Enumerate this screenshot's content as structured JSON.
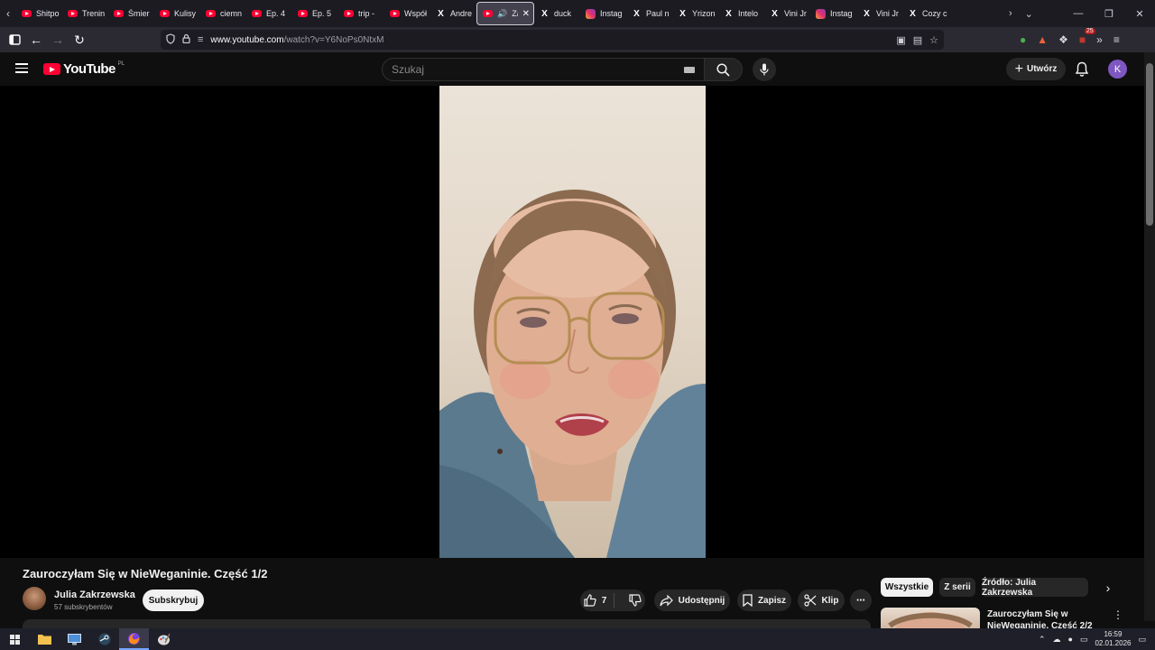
{
  "browser": {
    "tabs": [
      {
        "label": "Shitpo",
        "icon": "youtube-icon"
      },
      {
        "label": "Trenin",
        "icon": "youtube-icon"
      },
      {
        "label": "Śmier",
        "icon": "youtube-icon"
      },
      {
        "label": "Kulisy",
        "icon": "youtube-icon"
      },
      {
        "label": "ciemn",
        "icon": "youtube-icon"
      },
      {
        "label": "Ep. 4",
        "icon": "youtube-icon"
      },
      {
        "label": "Ep. 5",
        "icon": "youtube-icon"
      },
      {
        "label": "trip -",
        "icon": "youtube-icon"
      },
      {
        "label": "Współ",
        "icon": "youtube-icon"
      },
      {
        "label": "Andre",
        "icon": "x-icon"
      },
      {
        "label": "Zau",
        "icon": "youtube-icon",
        "active": true
      },
      {
        "label": "duck",
        "icon": "x-icon"
      },
      {
        "label": "Instag",
        "icon": "instagram-icon"
      },
      {
        "label": "Paul n",
        "icon": "x-icon"
      },
      {
        "label": "Yrizon",
        "icon": "x-icon"
      },
      {
        "label": "Intelo",
        "icon": "x-icon"
      },
      {
        "label": "Vini Jr",
        "icon": "x-icon"
      },
      {
        "label": "Instag",
        "icon": "instagram-icon"
      },
      {
        "label": "Vini Jr",
        "icon": "x-icon"
      },
      {
        "label": "Cozy c",
        "icon": "x-icon"
      }
    ],
    "url_domain": "www.youtube.com",
    "url_path": "/watch?v=Y6NoPs0NtxM",
    "extension_badge": "25"
  },
  "youtube": {
    "logo_text": "YouTube",
    "country_code": "PL",
    "search_placeholder": "Szukaj",
    "create_label": "Utwórz",
    "avatar_letter": "K",
    "avatar_color": "#7e57c2"
  },
  "video": {
    "title": "Zauroczyłam Się w NieWeganinie. Część 1/2",
    "channel_name": "Julia Zakrzewska",
    "subscribers": "57 subskrybentów",
    "subscribe_label": "Subskrybuj",
    "likes": "7",
    "share_label": "Udostępnij",
    "save_label": "Zapisz",
    "clip_label": "Klip"
  },
  "sidebar": {
    "chips": [
      "Wszystkie",
      "Z serii",
      "Źródło: Julia Zakrzewska"
    ],
    "active_chip": "Wszystkie",
    "recommendation_title": "Zauroczyłam Się w NieWeganinie. Część 2/2"
  },
  "taskbar": {
    "time": "16:59",
    "date": "02.01.2026"
  }
}
